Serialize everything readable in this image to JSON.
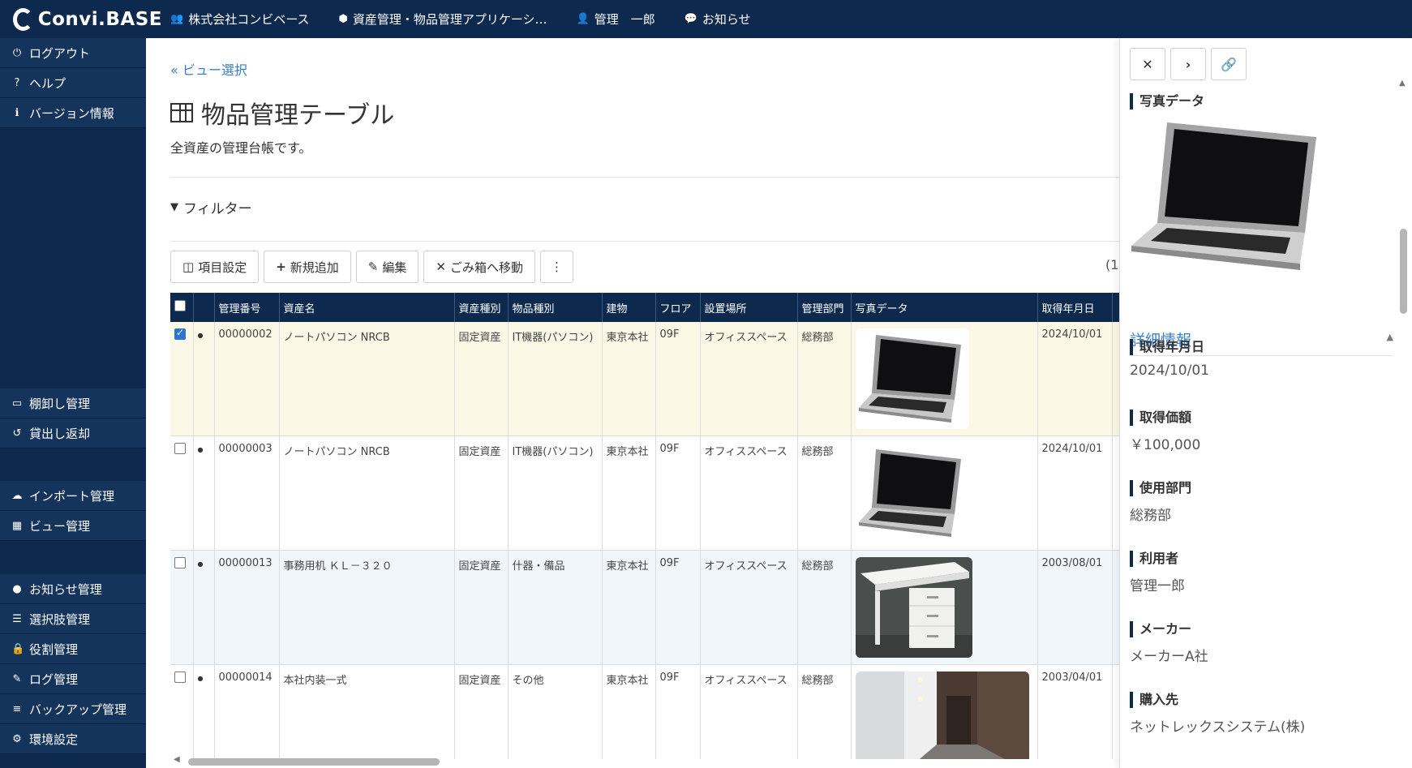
{
  "topbar": {
    "logo": "Convi.BASE",
    "company": "株式会社コンビベース",
    "app": "資産管理・物品管理アプリケーシ…",
    "user": "管理　一郎",
    "notice": "お知らせ"
  },
  "sidebar": {
    "items": [
      {
        "label": "ログアウト",
        "icon": "power-icon"
      },
      {
        "label": "ヘルプ",
        "icon": "help-icon"
      },
      {
        "label": "バージョン情報",
        "icon": "info-icon"
      },
      {
        "label": "棚卸し管理",
        "icon": "monitor-icon"
      },
      {
        "label": "貸出し返却",
        "icon": "undo-icon"
      },
      {
        "label": "インポート管理",
        "icon": "cloud-upload-icon"
      },
      {
        "label": "ビュー管理",
        "icon": "table-icon"
      },
      {
        "label": "お知らせ管理",
        "icon": "comment-icon"
      },
      {
        "label": "選択肢管理",
        "icon": "list-icon"
      },
      {
        "label": "役割管理",
        "icon": "lock-icon"
      },
      {
        "label": "ログ管理",
        "icon": "edit-icon"
      },
      {
        "label": "バックアップ管理",
        "icon": "database-icon"
      },
      {
        "label": "環境設定",
        "icon": "cogs-icon"
      }
    ]
  },
  "main": {
    "breadcrumb": "« ビュー選択",
    "title": "物品管理テーブル",
    "description": "全資産の管理台帳です。",
    "filter": "フィルター",
    "toolbar": {
      "columns": "項目設定",
      "add": "新規追加",
      "edit": "編集",
      "trash": "ごみ箱へ移動",
      "more": "⋮"
    },
    "count": "(1"
  },
  "table": {
    "headers": [
      "管理番号",
      "資産名",
      "資産種別",
      "物品種別",
      "建物",
      "フロア",
      "設置場所",
      "管理部門",
      "写真データ",
      "取得年月日"
    ],
    "rows": [
      {
        "checked": true,
        "id": "00000002",
        "name": "ノートパソコン NRCB",
        "asset_type": "固定資産",
        "item_type": "IT機器(パソコン)",
        "building": "東京本社",
        "floor": "09F",
        "location": "オフィススペース",
        "dept": "総務部",
        "photo": "laptop",
        "date": "2024/10/01"
      },
      {
        "checked": false,
        "id": "00000003",
        "name": "ノートパソコン NRCB",
        "asset_type": "固定資産",
        "item_type": "IT機器(パソコン)",
        "building": "東京本社",
        "floor": "09F",
        "location": "オフィススペース",
        "dept": "総務部",
        "photo": "laptop",
        "date": "2024/10/01"
      },
      {
        "checked": false,
        "id": "00000013",
        "name": "事務用机 ＫＬ－３２０",
        "asset_type": "固定資産",
        "item_type": "什器・備品",
        "building": "東京本社",
        "floor": "09F",
        "location": "オフィススペース",
        "dept": "総務部",
        "photo": "desk",
        "date": "2003/08/01"
      },
      {
        "checked": false,
        "id": "00000014",
        "name": "本社内装一式",
        "asset_type": "固定資産",
        "item_type": "その他",
        "building": "東京本社",
        "floor": "09F",
        "location": "オフィススペース",
        "dept": "総務部",
        "photo": "interior",
        "date": "2003/04/01"
      }
    ]
  },
  "panel": {
    "photo_label": "写真データ",
    "section": "詳細情報",
    "fields": [
      {
        "label": "取得年月日",
        "value": "2024/10/01"
      },
      {
        "label": "取得価額",
        "value": "￥100,000"
      },
      {
        "label": "使用部門",
        "value": "総務部"
      },
      {
        "label": "利用者",
        "value": "管理一郎"
      },
      {
        "label": "メーカー",
        "value": "メーカーA社"
      },
      {
        "label": "購入先",
        "value": "ネットレックスシステム(株)"
      }
    ]
  },
  "colors": {
    "navy": "#0d2a4e",
    "link": "#3a7fc4",
    "selected_row": "#fcf8e6"
  }
}
